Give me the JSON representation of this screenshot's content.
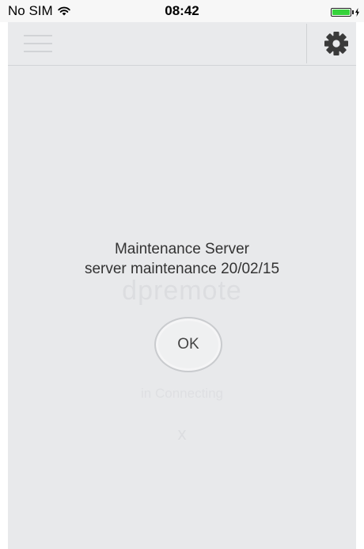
{
  "status_bar": {
    "carrier": "No SIM",
    "time": "08:42",
    "battery_level": 1.0,
    "battery_color": "#36d33b"
  },
  "navbar": {
    "menu_icon": "hamburger-menu-icon",
    "settings_icon": "gear-icon"
  },
  "background": {
    "logo_text": "dpremote",
    "status_text": "in Connecting",
    "close_symbol": "x"
  },
  "alert": {
    "title": "Maintenance Server",
    "message": "server maintenance 20/02/15",
    "ok_label": "OK"
  }
}
